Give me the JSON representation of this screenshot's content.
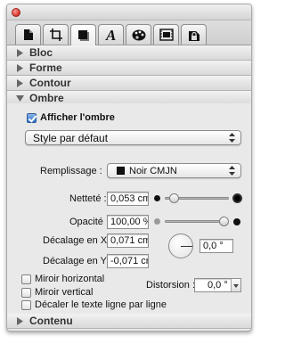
{
  "tabs": [
    {
      "icon": "document-icon",
      "active": false
    },
    {
      "icon": "crop-frame-icon",
      "active": false
    },
    {
      "icon": "graphic-square-icon",
      "active": true
    },
    {
      "icon": "text-a-icon",
      "active": false
    },
    {
      "icon": "palette-icon",
      "active": false
    },
    {
      "icon": "media-film-icon",
      "active": false
    },
    {
      "icon": "lock-icon",
      "active": false
    }
  ],
  "sections": {
    "bloc": "Bloc",
    "forme": "Forme",
    "contour": "Contour",
    "ombre": "Ombre",
    "contenu": "Contenu"
  },
  "shadow": {
    "show_label": "Afficher l'ombre",
    "show_checked": true,
    "style_value": "Style par défaut",
    "fill_label": "Remplissage :",
    "fill_value": "Noir CMJN",
    "fill_color": "#111111",
    "sharpness_label": "Netteté :",
    "sharpness_value": "0,053 cm",
    "sharpness_level": 0.08,
    "opacity_label": "Opacité :",
    "opacity_value": "100,00 %",
    "opacity_level": 1.0,
    "offset_x_label": "Décalage en X :",
    "offset_x_value": "0,071 cm",
    "offset_y_label": "Décalage en Y :",
    "offset_y_value": "-0,071 cm",
    "angle_value": "0,0 °",
    "mirror_h_label": "Miroir horizontal",
    "mirror_v_label": "Miroir vertical",
    "offset_text_label": "Décaler le texte ligne par ligne",
    "distortion_label": "Distorsion :",
    "distortion_value": "0,0 °"
  }
}
